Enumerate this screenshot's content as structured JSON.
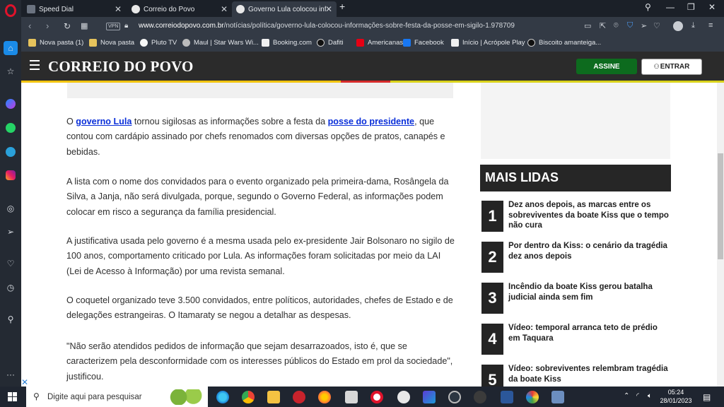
{
  "browser": {
    "tabs": [
      {
        "title": "Speed Dial",
        "active": false
      },
      {
        "title": "Correio do Povo",
        "active": false
      },
      {
        "title": "Governo Lula colocou infor",
        "active": true
      }
    ],
    "new_tab": "+",
    "vpn": "VPN",
    "url_domain": "www.correiodopovo.com.br",
    "url_path": "/notícias/política/governo-lula-colocou-informações-sobre-festa-da-posse-em-sigilo-1.978709",
    "bookmarks": [
      "Nova pasta (1)",
      "Nova pasta",
      "Pluto TV",
      "Maul | Star Wars Wi...",
      "Booking.com",
      "Dafiti",
      "Americanas",
      "Facebook",
      "Início | Acrópole Play",
      "Biscoito amanteiga..."
    ]
  },
  "site": {
    "logo": "CORREIO DO POVO",
    "subscribe": "ASSINE",
    "login": "ENTRAR"
  },
  "article": {
    "p1": {
      "pre": "O ",
      "link1": "governo Lula",
      "mid": " tornou sigilosas as informações sobre a festa da ",
      "link2": "posse do presidente",
      "post": ", que contou com cardápio assinado por chefs renomados com diversas opções de pratos, canapés e bebidas."
    },
    "p2": "A lista com o nome dos convidados para o evento organizado pela primeira-dama, Rosângela da Silva, a Janja, não será divulgada, porque, segundo o Governo Federal, as informações podem colocar em risco a segurança da família presidencial.",
    "p3": "A justificativa usada pelo governo é a mesma usada pelo ex-presidente Jair Bolsonaro no sigilo de 100 anos, comportamento criticado por Lula. As informações foram solicitadas por meio da LAI (Lei de Acesso à Informação) por uma revista semanal.",
    "p4": "O coquetel organizado teve 3.500 convidados, entre políticos, autoridades, chefes de Estado e de delegações estrangeiras. O Itamaraty se negou a detalhar as despesas.",
    "p5": "\"Não serão atendidos pedidos de informação que sejam desarrazoados, isto é, que se caracterizem pela desconformidade com os interesses públicos do Estado em prol da sociedade\", justificou."
  },
  "mais_lidas": {
    "title": "MAIS LIDAS",
    "items": [
      {
        "num": "1",
        "text": "Dez anos depois, as marcas entre os sobreviventes da boate Kiss que o tempo não cura"
      },
      {
        "num": "2",
        "text": "Por dentro da Kiss: o cenário da tragédia dez anos depois"
      },
      {
        "num": "3",
        "text": "Incêndio da boate Kiss gerou batalha judicial ainda sem fim"
      },
      {
        "num": "4",
        "text": "Vídeo: temporal arranca teto de prédio em Taquara"
      },
      {
        "num": "5",
        "text": "Vídeo: sobreviventes relembram tragédia da boate Kiss"
      }
    ]
  },
  "taskbar": {
    "search_placeholder": "Digite aqui para pesquisar",
    "time": "05:24",
    "date": "28/01/2023"
  },
  "colors": {
    "accent_link": "#0a2fd9",
    "subscribe_green": "#0d6b1e",
    "header_dark": "#2b2b2b"
  }
}
